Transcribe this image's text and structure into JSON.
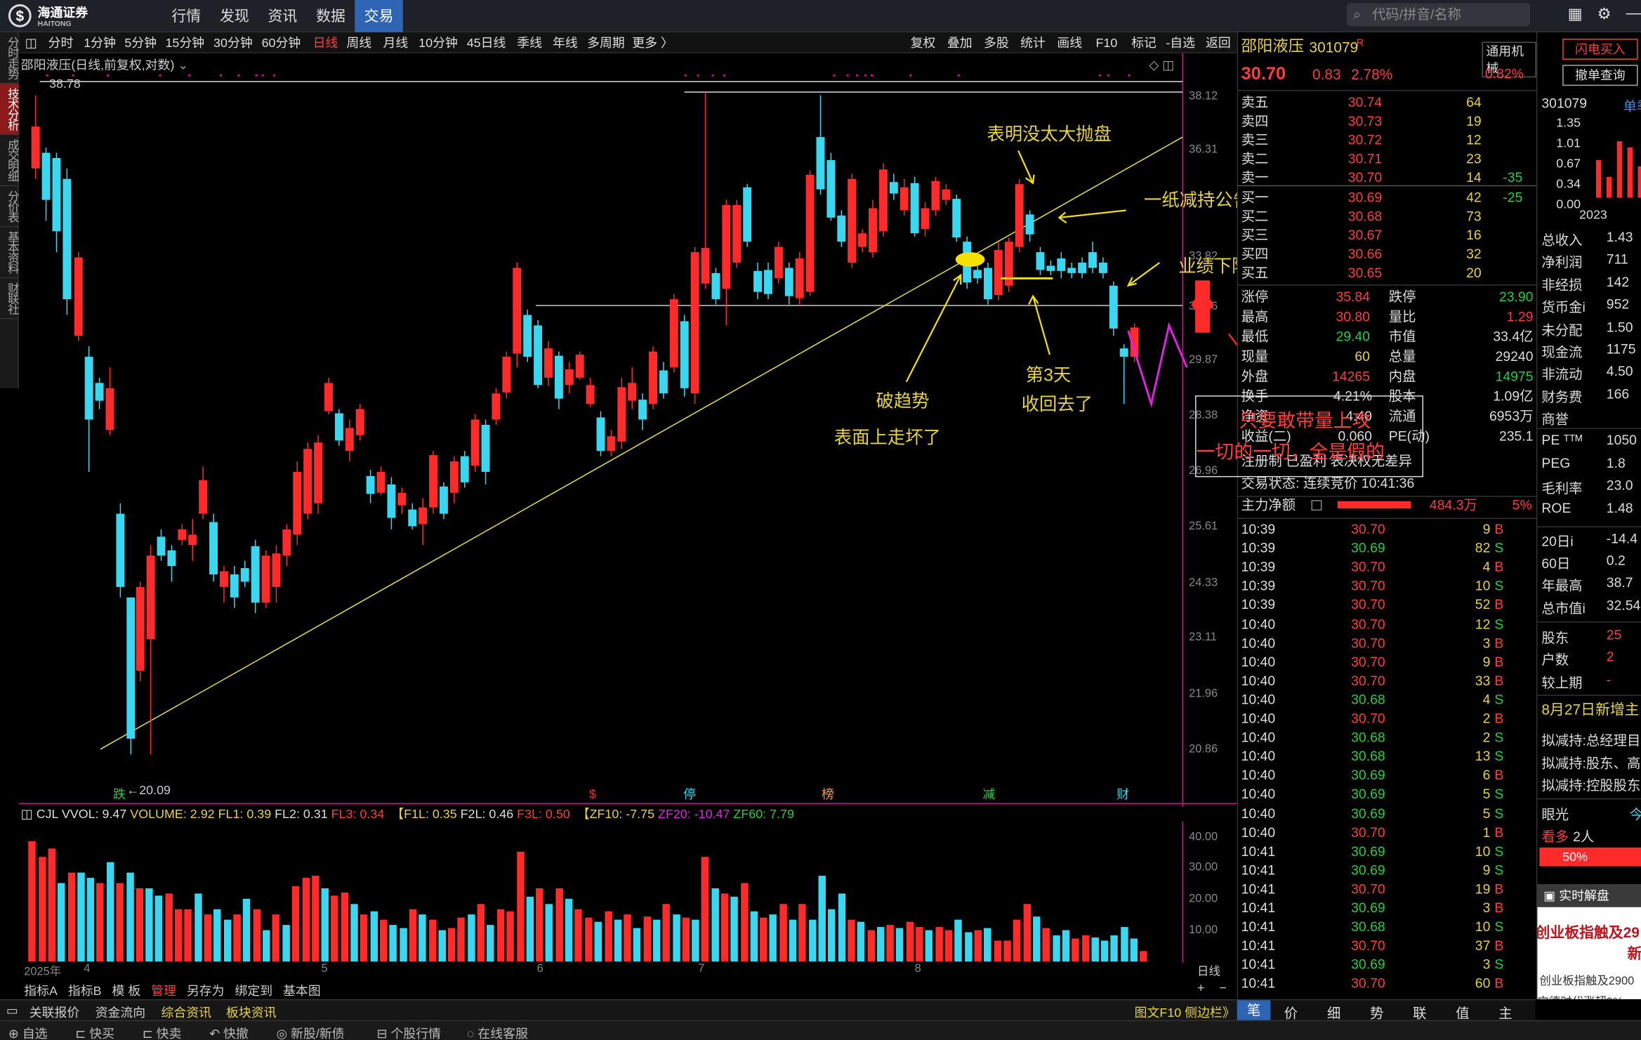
{
  "app": {
    "logo_text": "海通证券",
    "logo_sub": "HAITONG",
    "nav": [
      "行情",
      "发现",
      "资讯",
      "数据",
      "交易"
    ],
    "search_placeholder": "代码/拼音/名称"
  },
  "left_tabs": [
    "分时走势",
    "技术分析",
    "成交明细",
    "分价表",
    "基本资料",
    "财联社"
  ],
  "periods": [
    "分时",
    "1分钟",
    "5分钟",
    "15分钟",
    "30分钟",
    "60分钟",
    "日线",
    "周线",
    "月线",
    "10分钟",
    "45日线",
    "季线",
    "年线",
    "多周期",
    "更多 〉"
  ],
  "tools": [
    "复权",
    "叠加",
    "多股",
    "统计",
    "画线",
    "F10",
    "标记",
    "-自选",
    "返回"
  ],
  "chart": {
    "title": "邵阳液压(日线,前复权,对数)",
    "low_label": "←20.09",
    "high_label": "38.78",
    "y_ticks": [
      "38.12",
      "36.31",
      "33.82",
      "31.36",
      "29.87",
      "28.38",
      "26.96",
      "25.61",
      "24.33",
      "23.11",
      "21.96",
      "20.86"
    ],
    "markers": [
      "跌",
      "$",
      "停",
      "榜",
      "减",
      "财"
    ]
  },
  "annotations": {
    "a1": "表明没太大抛盘",
    "a2": "一纸减持公告（打乱计划）",
    "a3": "业绩下降，顺势破位",
    "a4": "破趋势",
    "a5": "表面上走坏了",
    "a6": "第3天",
    "a7": "收回去了",
    "a8": "只要敢带量上攻",
    "a9": "一切的一切，全是假的"
  },
  "volume": {
    "header": {
      "cjl": "CJL",
      "vvol": "VVOL: 9.47",
      "volume": "VOLUME: 2.92",
      "fl1": "FL1: 0.39",
      "fl2": "FL2: 0.31",
      "fl3": "FL3: 0.34",
      "f1l": "【F1L: 0.35",
      "f2l": "F2L: 0.46",
      "f3l": "F3L: 0.50",
      "zf10": "【ZF10: -7.75",
      "zf20": "ZF20: -10.47",
      "zf60": "ZF60: 7.79"
    },
    "y_ticks": [
      "40.00",
      "30.00",
      "20.00",
      "10.00"
    ]
  },
  "date_axis": [
    "2025年",
    "4",
    "5",
    "6",
    "7",
    "8",
    "日线"
  ],
  "bottom_tabs": [
    "指标A",
    "指标B",
    "模 板",
    "管理",
    "另存为",
    "绑定到",
    "基本图"
  ],
  "info_bar": {
    "left": [
      "关联报价",
      "资金流向",
      "综合资讯",
      "板块资讯"
    ],
    "right": "图文F10 侧边栏》"
  },
  "status_bar": [
    "自选",
    "快买",
    "快卖",
    "快撤",
    "新股/新债",
    "个股行情",
    "在线客服"
  ],
  "stock": {
    "name": "邵阳液压",
    "code": "301079",
    "r": "R",
    "price": "30.70",
    "change": "0.83",
    "pct": "2.78%",
    "badge1": "通用机械",
    "badge2": "0.82%"
  },
  "order_book": {
    "asks": [
      [
        "卖五",
        "30.74",
        "64",
        ""
      ],
      [
        "卖四",
        "30.73",
        "19",
        ""
      ],
      [
        "卖三",
        "30.72",
        "12",
        ""
      ],
      [
        "卖二",
        "30.71",
        "23",
        ""
      ],
      [
        "卖一",
        "30.70",
        "14",
        "-35"
      ]
    ],
    "bids": [
      [
        "买一",
        "30.69",
        "42",
        "-25"
      ],
      [
        "买二",
        "30.68",
        "73",
        ""
      ],
      [
        "买三",
        "30.67",
        "16",
        ""
      ],
      [
        "买四",
        "30.66",
        "32",
        ""
      ],
      [
        "买五",
        "30.65",
        "20",
        ""
      ]
    ]
  },
  "stats": [
    [
      "涨停",
      "35.84",
      "跌停",
      "23.90"
    ],
    [
      "最高",
      "30.80",
      "量比",
      "1.29"
    ],
    [
      "最低",
      "29.40",
      "市值",
      "33.4亿"
    ],
    [
      "现量",
      "60",
      "总量",
      "29240"
    ],
    [
      "外盘",
      "14265",
      "内盘",
      "14975"
    ],
    [
      "换手",
      "4.21%",
      "股本",
      "1.09亿"
    ],
    [
      "净资",
      "4.40",
      "流通",
      "6953万"
    ],
    [
      "收益(二)",
      "0.060",
      "PE(动)",
      "235.1"
    ]
  ],
  "misc": {
    "reg": "注册制 已盈利 表决权无差异",
    "trade_state": "交易状态: 连续竞价 10:41:36",
    "main_flow_label": "主力净额",
    "main_flow_value": "484.3万",
    "main_flow_pct": "5%"
  },
  "ticks": [
    [
      "10:39",
      "30.70",
      "9",
      "B"
    ],
    [
      "10:39",
      "30.69",
      "82",
      "S"
    ],
    [
      "10:39",
      "30.70",
      "4",
      "B"
    ],
    [
      "10:39",
      "30.70",
      "10",
      "S"
    ],
    [
      "10:39",
      "30.70",
      "52",
      "B"
    ],
    [
      "10:40",
      "30.70",
      "12",
      "S"
    ],
    [
      "10:40",
      "30.70",
      "3",
      "B"
    ],
    [
      "10:40",
      "30.70",
      "9",
      "B"
    ],
    [
      "10:40",
      "30.70",
      "33",
      "B"
    ],
    [
      "10:40",
      "30.68",
      "4",
      "S"
    ],
    [
      "10:40",
      "30.70",
      "2",
      "B"
    ],
    [
      "10:40",
      "30.68",
      "2",
      "S"
    ],
    [
      "10:40",
      "30.68",
      "13",
      "S"
    ],
    [
      "10:40",
      "30.69",
      "6",
      "B"
    ],
    [
      "10:40",
      "30.69",
      "5",
      "S"
    ],
    [
      "10:40",
      "30.69",
      "5",
      "S"
    ],
    [
      "10:40",
      "30.70",
      "1",
      "B"
    ],
    [
      "10:41",
      "30.69",
      "10",
      "S"
    ],
    [
      "10:41",
      "30.69",
      "9",
      "S"
    ],
    [
      "10:41",
      "30.70",
      "19",
      "B"
    ],
    [
      "10:41",
      "30.69",
      "3",
      "B"
    ],
    [
      "10:41",
      "30.68",
      "10",
      "S"
    ],
    [
      "10:41",
      "30.70",
      "37",
      "B"
    ],
    [
      "10:41",
      "30.69",
      "3",
      "S"
    ],
    [
      "10:41",
      "30.70",
      "60",
      "B"
    ]
  ],
  "right_tabs": [
    "笔",
    "价",
    "细",
    "势",
    "联",
    "值",
    "主"
  ],
  "side": {
    "btn1": "闪电买入",
    "btn2": "撤单查询",
    "code": "301079",
    "unit": "单季",
    "bars_y": [
      "1.35",
      "1.01",
      "0.67",
      "0.34",
      "0.00"
    ],
    "year": "2023",
    "fin": [
      [
        "总收入",
        "1.43"
      ],
      [
        "净利润",
        "711"
      ],
      [
        "非经损",
        "142"
      ],
      [
        "货币金i",
        "952"
      ],
      [
        "未分配",
        "1.50"
      ],
      [
        "现金流",
        "1175"
      ],
      [
        "非流动",
        "4.50"
      ],
      [
        "财务费",
        "166"
      ],
      [
        "商誉",
        ""
      ]
    ],
    "pe": [
      [
        "PE ᵀᵀᴹ",
        "1050"
      ],
      [
        "PEG",
        "1.8"
      ],
      [
        "毛利率",
        "23.0"
      ],
      [
        "ROE",
        "1.48"
      ]
    ],
    "perf": [
      [
        "20日i",
        "-14.4"
      ],
      [
        "60日",
        "0.2"
      ],
      [
        "年最高",
        "38.7"
      ],
      [
        "总市值i",
        "32.54"
      ]
    ],
    "holders": [
      [
        "股东",
        "25"
      ],
      [
        "户数",
        "2"
      ],
      [
        "较上期",
        "-"
      ]
    ],
    "news_head": "8月27日新增主",
    "news": [
      "拟减持:总经理目",
      "拟减持:股东、高",
      "拟减持:控股股东"
    ],
    "eye": "眼光",
    "eye_right": "今",
    "kanduo": "看多",
    "kanduo_n": "2人",
    "pct50": "50%",
    "live": "实时解盘",
    "live_t1": "创业板指触及29",
    "live_t2": "新",
    "live_t3": "创业板指触及2900",
    "live_t4": "股中宁德时代涨超9%。"
  }
}
